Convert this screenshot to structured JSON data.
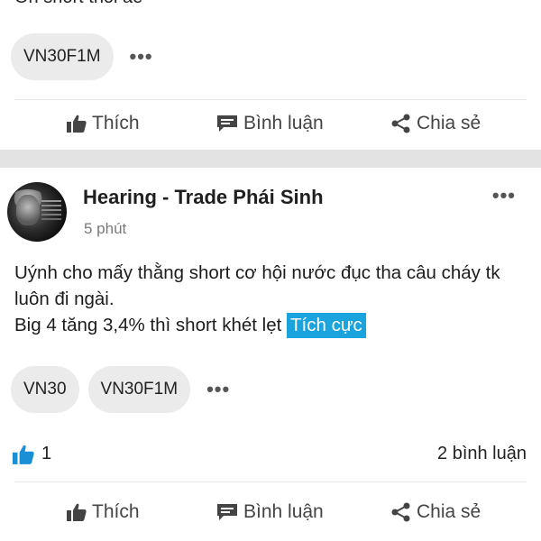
{
  "prev_post": {
    "cut_text": "Ổn short thôi ae",
    "tags": [
      "VN30F1M"
    ],
    "more_label": "•••",
    "actions": {
      "like": "Thích",
      "comment": "Bình luận",
      "share": "Chia sẻ"
    }
  },
  "post": {
    "author": "Hearing - Trade Phái Sinh",
    "time": "5 phút",
    "more_label": "•••",
    "content_line1": "Uýnh cho mấy thằng short cơ hội nước đục tha câu cháy tk luôn đi ngài.",
    "content_line2": "Big 4 tăng 3,4% thì short khét lẹt",
    "sentiment": "Tích cực",
    "tags": [
      "VN30",
      "VN30F1M"
    ],
    "like_count": "1",
    "comment_count": "2 bình luận",
    "actions": {
      "like": "Thích",
      "comment": "Bình luận",
      "share": "Chia sẻ"
    }
  },
  "colors": {
    "sentiment_bg": "#1aa3dd",
    "like_icon": "#1a8fd6",
    "separator": "#e3e3e3"
  }
}
